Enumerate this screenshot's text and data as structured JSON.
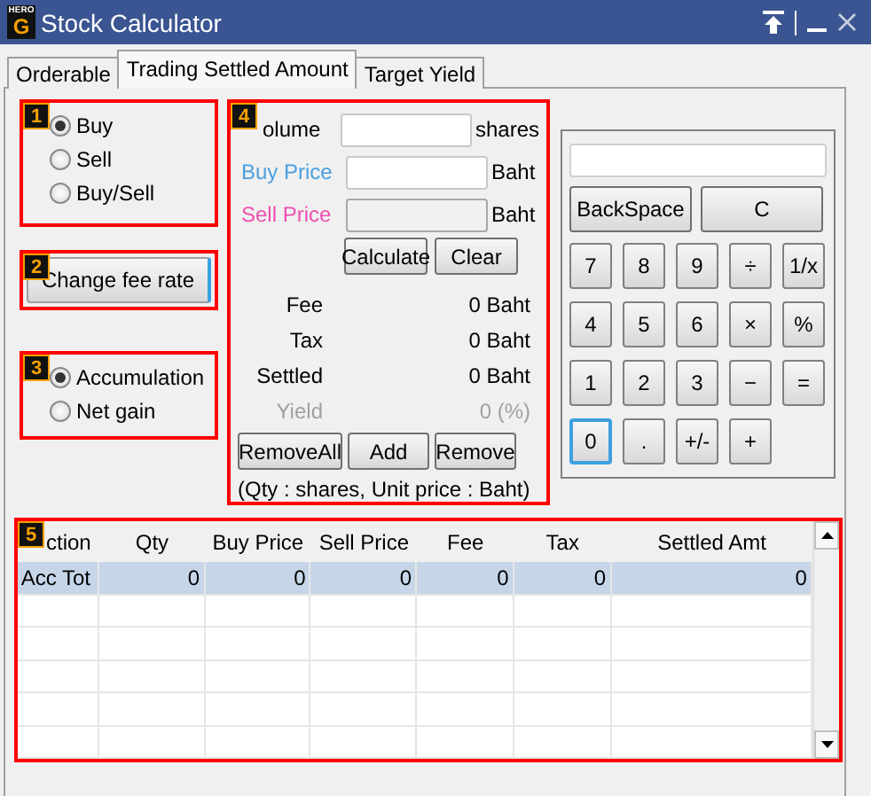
{
  "window": {
    "title": "Stock Calculator",
    "logo": {
      "top": "HERO",
      "letter": "G"
    }
  },
  "tabs": [
    {
      "label": "Orderable",
      "selected": false
    },
    {
      "label": "Trading Settled Amount",
      "selected": true
    },
    {
      "label": "Target Yield",
      "selected": false
    }
  ],
  "side_mode": {
    "badge": "1",
    "options": [
      {
        "label": "Buy",
        "selected": true
      },
      {
        "label": "Sell",
        "selected": false
      },
      {
        "label": "Buy/Sell",
        "selected": false
      }
    ]
  },
  "fee": {
    "badge": "2",
    "button": "Change fee rate"
  },
  "result_mode": {
    "badge": "3",
    "options": [
      {
        "label": "Accumulation",
        "selected": true
      },
      {
        "label": "Net gain",
        "selected": false
      }
    ]
  },
  "entry": {
    "badge": "4",
    "fields": [
      {
        "label": "olume",
        "color": "#000000",
        "unit": "shares",
        "disabled": false
      },
      {
        "label": "Buy Price",
        "color": "#4a9fe0",
        "unit": "Baht",
        "disabled": false
      },
      {
        "label": "Sell Price",
        "color": "#f050b0",
        "unit": "Baht",
        "disabled": true
      }
    ],
    "actions": [
      "Calculate",
      "Clear"
    ],
    "results": [
      {
        "label": "Fee",
        "value": "0 Baht",
        "disabled": false
      },
      {
        "label": "Tax",
        "value": "0 Baht",
        "disabled": false
      },
      {
        "label": "Settled",
        "value": "0 Baht",
        "disabled": false
      },
      {
        "label": "Yield",
        "value": "0 (%)",
        "disabled": true
      }
    ],
    "list_buttons": [
      "RemoveAll",
      "Add",
      "Remove"
    ],
    "note": "(Qty : shares, Unit price : Baht)"
  },
  "calculator": {
    "wide_keys": [
      "BackSpace",
      "C"
    ],
    "keys": [
      {
        "label": "7",
        "focused": false
      },
      {
        "label": "8",
        "focused": false
      },
      {
        "label": "9",
        "focused": false
      },
      {
        "label": "÷",
        "focused": false
      },
      {
        "label": "1/x",
        "focused": false
      },
      {
        "label": "4",
        "focused": false
      },
      {
        "label": "5",
        "focused": false
      },
      {
        "label": "6",
        "focused": false
      },
      {
        "label": "×",
        "focused": false
      },
      {
        "label": "%",
        "focused": false
      },
      {
        "label": "1",
        "focused": false
      },
      {
        "label": "2",
        "focused": false
      },
      {
        "label": "3",
        "focused": false
      },
      {
        "label": "−",
        "focused": false
      },
      {
        "label": "=",
        "focused": false
      },
      {
        "label": "0",
        "focused": true
      },
      {
        "label": ".",
        "focused": false
      },
      {
        "label": "+/-",
        "focused": false
      },
      {
        "label": "+",
        "focused": false
      }
    ]
  },
  "table": {
    "badge": "5",
    "columns": [
      "ction",
      "Qty",
      "Buy Price",
      "Sell Price",
      "Fee",
      "Tax",
      "Settled Amt"
    ],
    "rows": [
      {
        "cells": [
          "Acc Tot",
          "0",
          "0",
          "0",
          "0",
          "0",
          "0"
        ],
        "selected": true
      }
    ]
  }
}
